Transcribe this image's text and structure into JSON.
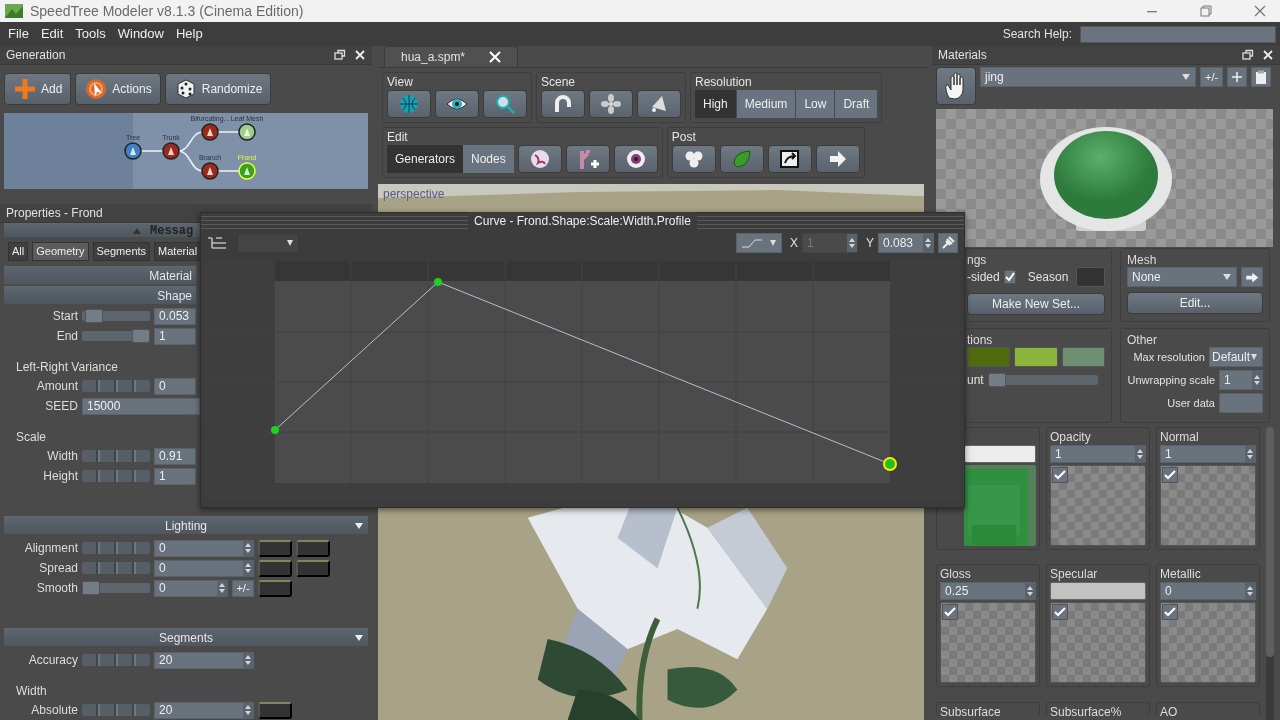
{
  "window": {
    "title": "SpeedTree Modeler v8.1.3 (Cinema Edition)"
  },
  "menu": [
    {
      "label": "File"
    },
    {
      "label": "Edit"
    },
    {
      "label": "Tools"
    },
    {
      "label": "Window"
    },
    {
      "label": "Help"
    }
  ],
  "search_help": {
    "label": "Search Help:"
  },
  "generation": {
    "title": "Generation",
    "buttons": [
      {
        "label": "Add",
        "kind": "add"
      },
      {
        "label": "Actions",
        "kind": "actions"
      },
      {
        "label": "Randomize",
        "kind": "randomize"
      }
    ],
    "nodes": [
      {
        "label": "Tree",
        "kind": "tree",
        "selected": false
      },
      {
        "label": "Trunk",
        "kind": "branch",
        "selected": false
      },
      {
        "label": "Bifurcating...",
        "kind": "branch",
        "selected": false
      },
      {
        "label": "Leaf Mesh",
        "kind": "leaf",
        "selected": false
      },
      {
        "label": "Branch",
        "kind": "branch",
        "selected": false
      },
      {
        "label": "Frond",
        "kind": "frond",
        "selected": true
      }
    ]
  },
  "properties": {
    "title": "Properties - Frond",
    "message_bar": "Messag",
    "tabs": [
      {
        "label": "All",
        "selected": false
      },
      {
        "label": "Geometry",
        "selected": true
      },
      {
        "label": "Segments",
        "selected": false
      },
      {
        "label": "Material",
        "selected": false
      }
    ],
    "rows": [
      {
        "kind": "subheader",
        "title": "Material"
      },
      {
        "kind": "subheader",
        "title": "Shape"
      },
      {
        "kind": "slider",
        "label": "Start",
        "level": 0.05,
        "value": "0.053",
        "spin": false
      },
      {
        "kind": "slider",
        "label": "End",
        "level": 1,
        "value": "1",
        "spin": false
      },
      {
        "kind": "group",
        "title": "Left-Right Variance"
      },
      {
        "kind": "wheel",
        "label": "Amount",
        "value": "0",
        "spin": false
      },
      {
        "kind": "text",
        "label": "SEED",
        "value": "15000"
      },
      {
        "kind": "group",
        "title": "Scale"
      },
      {
        "kind": "wheel",
        "label": "Width",
        "value": "0.91",
        "spin": false
      },
      {
        "kind": "wheel",
        "label": "Height",
        "value": "1",
        "spin": false
      },
      {
        "kind": "section",
        "title": "Lighting"
      },
      {
        "kind": "wheel",
        "label": "Alignment",
        "value": "0",
        "spin": true,
        "buttons": [
          {
            "kind": "curve"
          },
          {
            "kind": "curve"
          }
        ]
      },
      {
        "kind": "wheel",
        "label": "Spread",
        "value": "0",
        "spin": true,
        "buttons": [
          {
            "kind": "curve"
          },
          {
            "kind": "curve"
          }
        ]
      },
      {
        "kind": "slider",
        "label": "Smooth",
        "level": 0,
        "value": "0",
        "spin": true,
        "buttons": [
          {
            "kind": "toggle",
            "label": "+/-"
          },
          {
            "kind": "curve"
          }
        ]
      },
      {
        "kind": "section",
        "title": "Segments"
      },
      {
        "kind": "wheel",
        "label": "Accuracy",
        "value": "20",
        "spin": true
      },
      {
        "kind": "group",
        "title": "Width"
      },
      {
        "kind": "wheel",
        "label": "Absolute",
        "value": "20",
        "spin": true,
        "buttons": [
          {
            "kind": "curve"
          }
        ]
      }
    ]
  },
  "curve_editor": {
    "title": "Curve - Frond.Shape:Scale:Width.Profile",
    "x": {
      "label": "X",
      "value": "1",
      "disabled": true
    },
    "y": {
      "label": "Y",
      "value": "0.083",
      "disabled": false
    }
  },
  "document_tab": {
    "label": "hua_a.spm*"
  },
  "toolbar": {
    "view": {
      "title": "View"
    },
    "scene": {
      "title": "Scene"
    },
    "resolution": {
      "title": "Resolution",
      "options": [
        {
          "label": "High",
          "selected": true
        },
        {
          "label": "Medium",
          "selected": false
        },
        {
          "label": "Low",
          "selected": false
        },
        {
          "label": "Draft",
          "selected": false
        }
      ]
    },
    "edit": {
      "title": "Edit",
      "modes": [
        {
          "label": "Generators",
          "selected": true
        },
        {
          "label": "Nodes",
          "selected": false
        }
      ]
    },
    "post": {
      "title": "Post"
    }
  },
  "viewport": {
    "label": "perspective"
  },
  "materials": {
    "title": "Materials",
    "material": "jing",
    "toggle_label": "+/-",
    "settings": {
      "title": "ngs",
      "two_sided": {
        "label": "-sided",
        "checked": true
      },
      "season_label": "Season",
      "make_set": "Make New Set..."
    },
    "mesh": {
      "title": "Mesh",
      "value": "None",
      "edit": "Edit..."
    },
    "variations": {
      "title": "tions",
      "amount_label": "unt",
      "level": 0,
      "swatches": [
        {
          "color": "#4e6b0e"
        },
        {
          "color": "#8cb53b"
        },
        {
          "color": "#6f8f73"
        }
      ]
    },
    "other": {
      "title": "Other",
      "max_resolution": {
        "label": "Max resolution",
        "value": "Default"
      },
      "unwrapping_scale": {
        "label": "Unwrapping scale",
        "value": "1"
      },
      "user_data": {
        "label": "User data"
      }
    },
    "maps": [
      {
        "kind": "swatch",
        "color": "#ececec",
        "textured": true
      },
      {
        "kind": "spin",
        "label": "Opacity",
        "value": "1",
        "checked": true,
        "textured": false
      },
      {
        "kind": "spin",
        "label": "Normal",
        "value": "1",
        "checked": true,
        "textured": false
      },
      {
        "kind": "spin",
        "label": "Gloss",
        "value": "0.25",
        "checked": true,
        "textured": false
      },
      {
        "kind": "swatch",
        "label": "Specular",
        "color": "#c2c2c2",
        "checked": true,
        "textured": false
      },
      {
        "kind": "spin",
        "label": "Metallic",
        "value": "0",
        "checked": true,
        "textured": false
      },
      {
        "kind": "cut",
        "label": "Subsurface"
      },
      {
        "kind": "cut",
        "label": "Subsurface%"
      },
      {
        "kind": "cut",
        "label": "AO"
      }
    ]
  }
}
